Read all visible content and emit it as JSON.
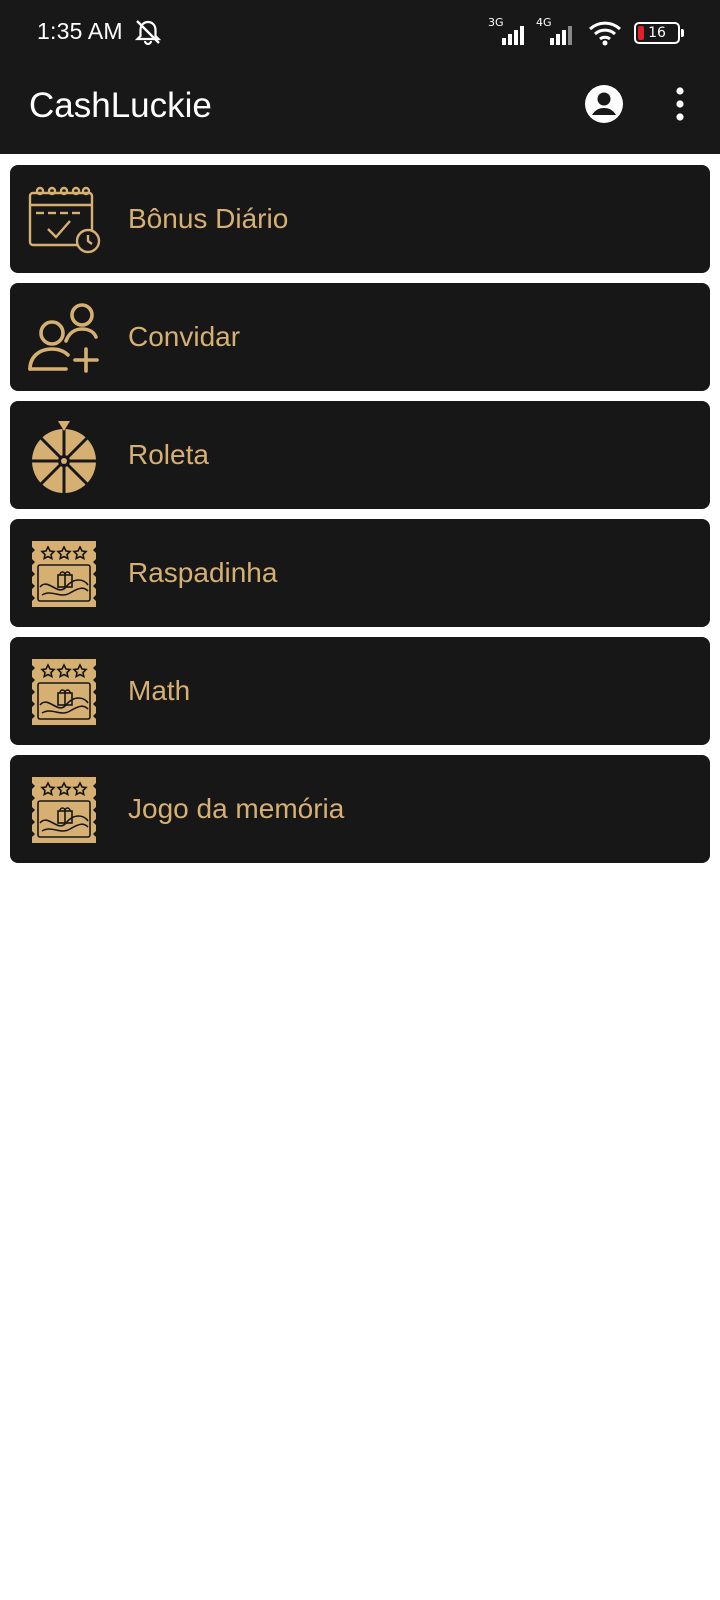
{
  "status_bar": {
    "time": "1:35 AM",
    "network_1": "3G",
    "network_2": "4G",
    "battery_level": "16",
    "icons": [
      "mute-alarm-icon",
      "signal-icon",
      "signal-icon",
      "wifi-icon",
      "battery-icon"
    ]
  },
  "app_bar": {
    "title": "CashLuckie",
    "icons": [
      "account-icon",
      "more-vert-icon"
    ]
  },
  "colors": {
    "bar_bg": "#181818",
    "card_bg": "#171717",
    "accent_gold": "#d6b073",
    "page_bg": "#ffffff",
    "battery_low": "#e0202a"
  },
  "menu": {
    "items": [
      {
        "label": "Bônus Diário",
        "icon": "calendar-check-icon"
      },
      {
        "label": "Convidar",
        "icon": "add-user-icon"
      },
      {
        "label": "Roleta",
        "icon": "roulette-wheel-icon"
      },
      {
        "label": "Raspadinha",
        "icon": "scratch-ticket-icon"
      },
      {
        "label": "Math",
        "icon": "scratch-ticket-icon"
      },
      {
        "label": "Jogo da memória",
        "icon": "scratch-ticket-icon"
      }
    ]
  }
}
